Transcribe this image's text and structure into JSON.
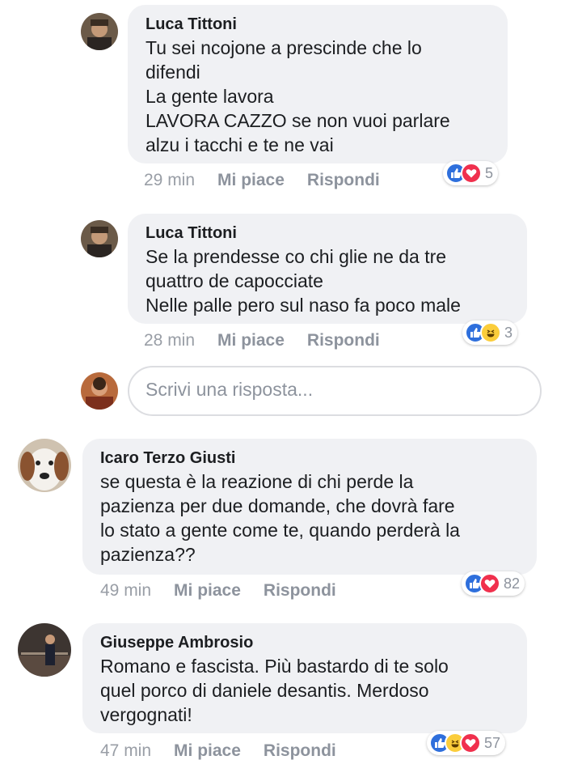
{
  "comments": [
    {
      "author": "Luca Tittoni",
      "lines": [
        "Tu sei ncojone a prescinde che lo",
        "difendi",
        "La gente lavora",
        "LAVORA CAZZO se non vuoi parlare",
        "alzu i tacchi e te ne vai"
      ],
      "time": "29 min",
      "like_label": "Mi piace",
      "reply_label": "Rispondi",
      "reactions": [
        "like-icon",
        "love-icon"
      ],
      "reaction_count": "5"
    },
    {
      "author": "Luca Tittoni",
      "lines": [
        "Se la prendesse co chi glie ne da tre",
        "quattro de capocciate",
        "Nelle palle pero sul naso fa poco male"
      ],
      "time": "28 min",
      "like_label": "Mi piace",
      "reply_label": "Rispondi",
      "reactions": [
        "like-icon",
        "haha-icon"
      ],
      "reaction_count": "3"
    },
    {
      "author": "Icaro Terzo Giusti",
      "lines": [
        "se questa è la reazione di chi perde la",
        "pazienza per due domande, che dovrà fare",
        "lo stato a gente come te, quando perderà la",
        "pazienza??"
      ],
      "time": "49 min",
      "like_label": "Mi piace",
      "reply_label": "Rispondi",
      "reactions": [
        "like-icon",
        "love-icon"
      ],
      "reaction_count": "82"
    },
    {
      "author": "Giuseppe Ambrosio",
      "lines": [
        "Romano e fascista. Più  bastardo di te solo",
        "quel porco di daniele desantis. Merdoso",
        "vergognati!"
      ],
      "time": "47 min",
      "like_label": "Mi piace",
      "reply_label": "Rispondi",
      "reactions": [
        "like-icon",
        "haha-icon",
        "love-icon"
      ],
      "reaction_count": "57"
    }
  ],
  "reply_input": {
    "placeholder": "Scrivi una risposta..."
  },
  "colors": {
    "bubble": "#f0f1f4",
    "like": "#2e6fdc",
    "love": "#f0304d",
    "haha": "#fbcd3b",
    "meta": "#8d939d"
  }
}
